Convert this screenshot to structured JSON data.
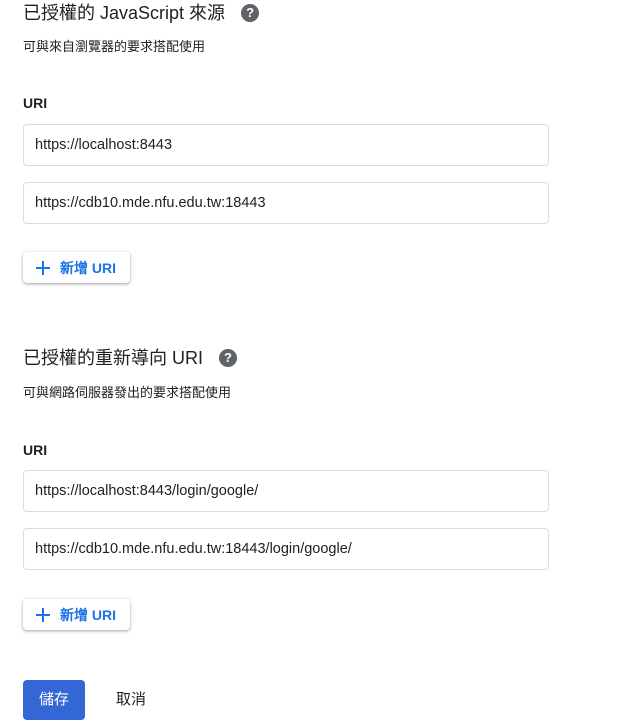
{
  "js_origins": {
    "title": "已授權的 JavaScript 來源",
    "subtitle": "可與來自瀏覽器的要求搭配使用",
    "uri_label": "URI",
    "uris": [
      "https://localhost:8443",
      "https://cdb10.mde.nfu.edu.tw:18443"
    ],
    "add_label": "新增 URI"
  },
  "redirect_uris": {
    "title": "已授權的重新導向 URI",
    "subtitle": "可與網路伺服器發出的要求搭配使用",
    "uri_label": "URI",
    "uris": [
      "https://localhost:8443/login/google/",
      "https://cdb10.mde.nfu.edu.tw:18443/login/google/"
    ],
    "add_label": "新增 URI"
  },
  "help_icon_glyph": "?",
  "actions": {
    "save_label": "儲存",
    "cancel_label": "取消"
  },
  "colors": {
    "accent": "#1a73e8",
    "primary_button": "#3367d6",
    "help_icon": "#5f6368",
    "border": "#dadce0"
  }
}
